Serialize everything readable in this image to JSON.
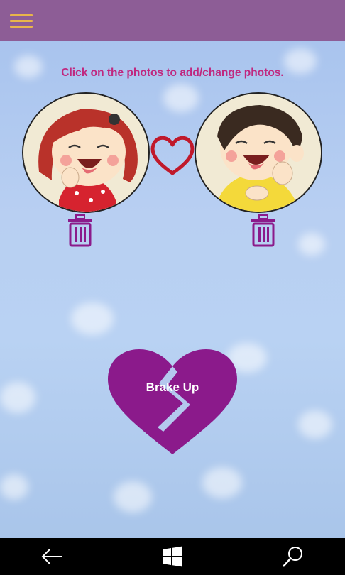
{
  "app_bar": {
    "menu_icon": "hamburger-icon"
  },
  "main": {
    "instruction": "Click on the photos to add/change photos.",
    "left_photo": {
      "icon": "girl-photo"
    },
    "right_photo": {
      "icon": "boy-photo"
    },
    "delete_icon": "trash-icon",
    "heart_icon": "heart-icon",
    "breakup_button_label": "Brake Up"
  },
  "nav_bar": {
    "back_icon": "back-arrow-icon",
    "home_icon": "windows-logo-icon",
    "search_icon": "search-icon"
  },
  "colors": {
    "app_bar": "#8d5d96",
    "accent_menu": "#e8b54a",
    "instruction_text": "#c0287f",
    "purple": "#8b1a8b",
    "heart_red": "#c0192b"
  }
}
